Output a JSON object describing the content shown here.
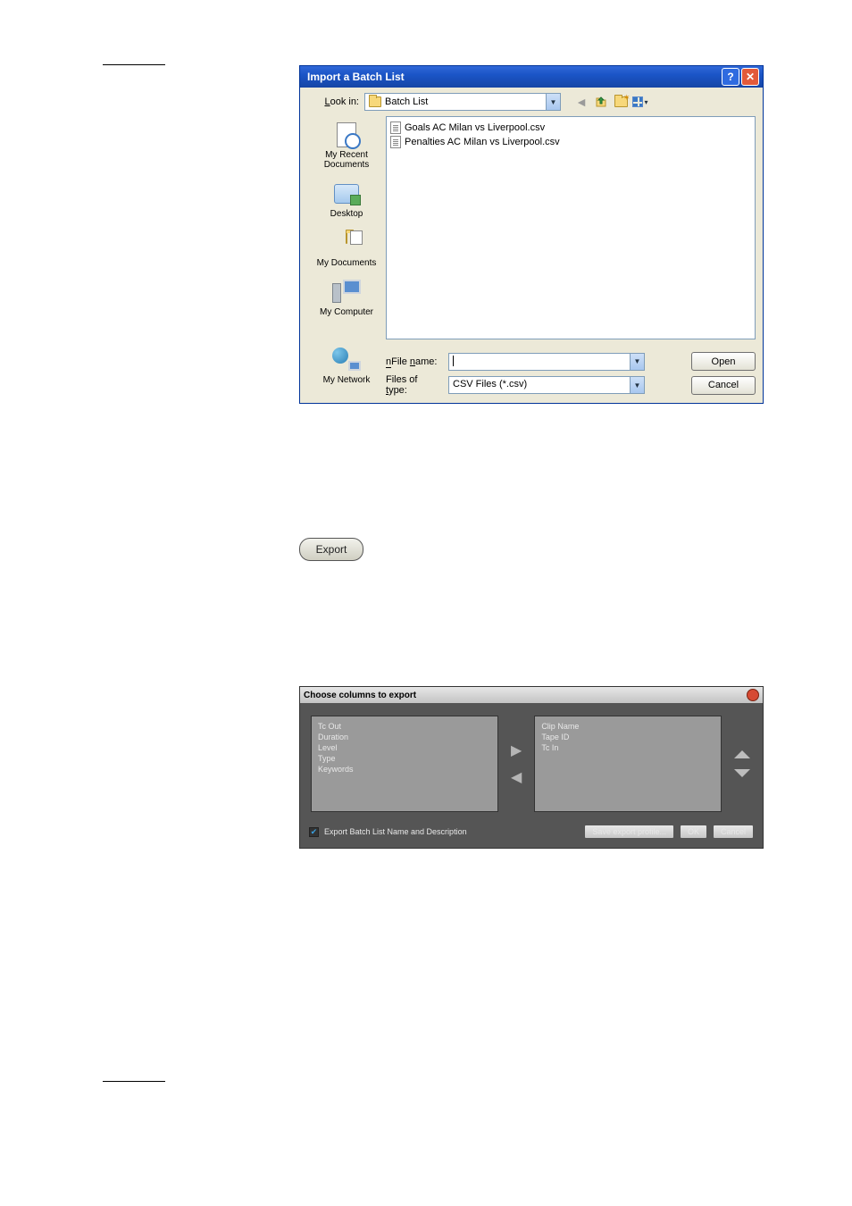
{
  "xpDialog": {
    "title": "Import a Batch List",
    "lookInLabel": "Look in:",
    "lookInValue": "Batch List",
    "files": [
      "Goals AC Milan vs Liverpool.csv",
      "Penalties AC Milan vs Liverpool.csv"
    ],
    "places": {
      "recent": "My Recent Documents",
      "desktop": "Desktop",
      "mydocs": "My Documents",
      "mycomp": "My Computer",
      "mynet": "My Network"
    },
    "fileNameLabel": "File name:",
    "fileNameValue": "",
    "fileTypeLabel": "Files of type:",
    "fileTypeValue": "CSV Files (*.csv)",
    "openBtn": "Open",
    "cancelBtn": "Cancel"
  },
  "exportButton": "Export",
  "darkDialog": {
    "title": "Choose columns to export",
    "leftList": [
      "Tc Out",
      "Duration",
      "Level",
      "Type",
      "Keywords"
    ],
    "rightList": [
      "Clip Name",
      "Tape ID",
      "Tc In"
    ],
    "checkboxLabel": "Export Batch List Name and Description",
    "saveProfileBtn": "Save export profile...",
    "okBtn": "OK",
    "cancelBtn": "Cancel"
  }
}
